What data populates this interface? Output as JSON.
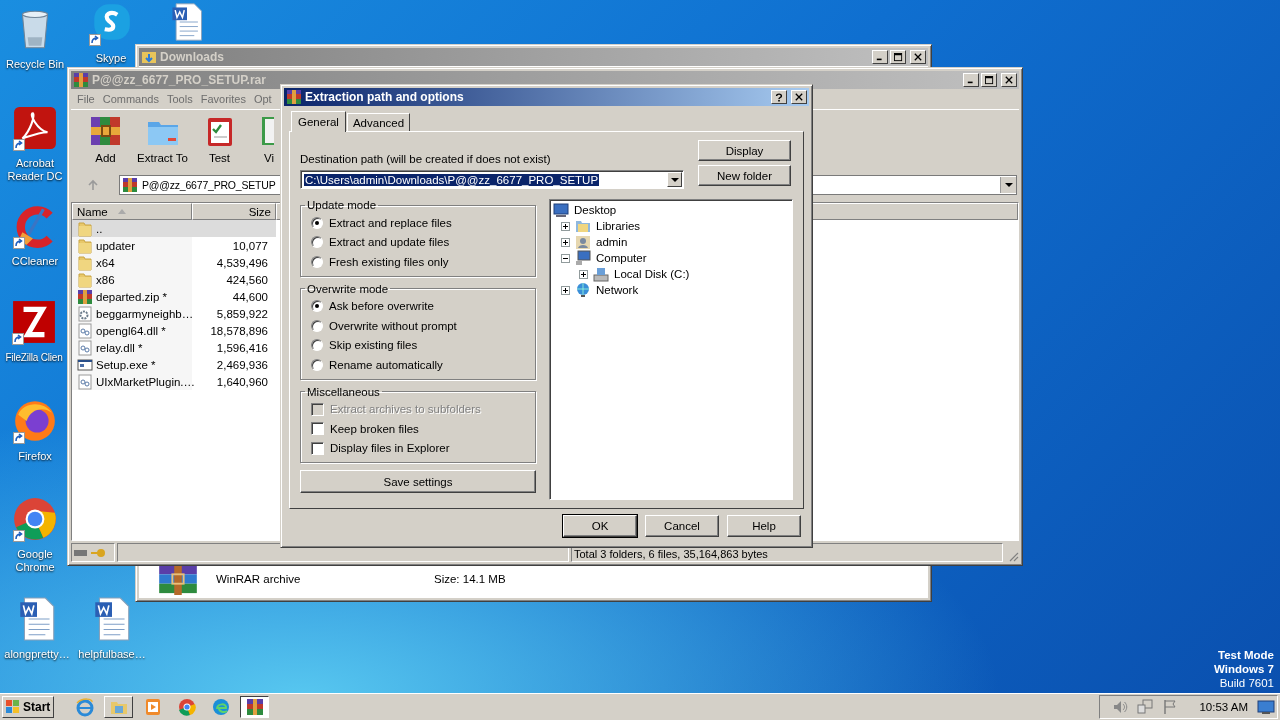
{
  "desktop_icons": [
    {
      "label": "Recycle Bin",
      "kind": "recycle",
      "shortcut": false
    },
    {
      "label": "Skype",
      "kind": "skype",
      "shortcut": true
    },
    {
      "kind": "word",
      "shortcut": false
    },
    {
      "label": "Acrobat Reader DC",
      "kind": "acrobat",
      "shortcut": true
    },
    {
      "label": "CCleaner",
      "kind": "ccleaner",
      "shortcut": true
    },
    {
      "label": "FileZilla Clien",
      "kind": "filezilla",
      "shortcut": true
    },
    {
      "label": "Firefox",
      "kind": "firefox",
      "shortcut": true
    },
    {
      "label": "Google Chrome",
      "kind": "chrome",
      "shortcut": true
    },
    {
      "label": "alongpretty…",
      "kind": "word",
      "shortcut": false
    },
    {
      "label": "helpfulbase…",
      "kind": "word",
      "shortcut": false
    }
  ],
  "downloads_window": {
    "title": "Downloads",
    "file_type": "WinRAR archive",
    "file_size": "Size: 14.1 MB"
  },
  "archive_window": {
    "title": "P@@zz_6677_PRO_SETUP.rar",
    "menu": [
      "File",
      "Commands",
      "Tools",
      "Favorites",
      "Opt"
    ],
    "toolbar": [
      {
        "label": "Add",
        "kind": "add"
      },
      {
        "label": "Extract To",
        "kind": "extract"
      },
      {
        "label": "Test",
        "kind": "test"
      },
      {
        "label": "Vi",
        "kind": "view"
      }
    ],
    "address": "P@@zz_6677_PRO_SETUP",
    "columns": [
      "Name",
      "Size"
    ],
    "rows": [
      {
        "name": "..",
        "kind": "parent",
        "selected": true
      },
      {
        "name": "updater",
        "size": "10,077",
        "kind": "folder",
        "selected": false
      },
      {
        "name": "x64",
        "size": "4,539,496",
        "kind": "folder",
        "selected": false
      },
      {
        "name": "x86",
        "size": "424,560",
        "kind": "folder",
        "selected": false
      },
      {
        "name": "departed.zip *",
        "size": "44,600",
        "kind": "archive",
        "selected": false
      },
      {
        "name": "beggarmyneighb…",
        "size": "5,859,922",
        "kind": "settings",
        "selected": false
      },
      {
        "name": "opengl64.dll *",
        "size": "18,578,896",
        "kind": "library",
        "selected": false
      },
      {
        "name": "relay.dll *",
        "size": "1,596,416",
        "kind": "library",
        "selected": false
      },
      {
        "name": "Setup.exe *",
        "size": "2,469,936",
        "kind": "program",
        "selected": false
      },
      {
        "name": "UIxMarketPlugin.…",
        "size": "1,640,960",
        "kind": "library",
        "selected": false
      }
    ],
    "status": "Total 3 folders, 6 files, 35,164,863 bytes"
  },
  "dialog": {
    "title": "Extraction path and options",
    "tabs": [
      {
        "label": "General",
        "selected": true
      },
      {
        "label": "Advanced",
        "selected": false
      }
    ],
    "path_label": "Destination path (will be created if does not exist)",
    "path_value": "C:\\Users\\admin\\Downloads\\P@@zz_6677_PRO_SETUP",
    "side_buttons": [
      "Display",
      "New folder"
    ],
    "update_mode": {
      "title": "Update mode",
      "options": [
        {
          "label": "Extract and replace files",
          "selected": true
        },
        {
          "label": "Extract and update files",
          "selected": false
        },
        {
          "label": "Fresh existing files only",
          "selected": false
        }
      ]
    },
    "overwrite_mode": {
      "title": "Overwrite mode",
      "options": [
        {
          "label": "Ask before overwrite",
          "selected": true
        },
        {
          "label": "Overwrite without prompt",
          "selected": false
        },
        {
          "label": "Skip existing files",
          "selected": false
        },
        {
          "label": "Rename automatically",
          "selected": false
        }
      ]
    },
    "miscellaneous": {
      "title": "Miscellaneous",
      "options": [
        {
          "label": "Extract archives to subfolders",
          "checked": false,
          "disabled": true
        },
        {
          "label": "Keep broken files",
          "checked": false,
          "disabled": false
        },
        {
          "label": "Display files in Explorer",
          "checked": false,
          "disabled": false
        }
      ]
    },
    "save_button": "Save settings",
    "tree": [
      {
        "label": "Desktop",
        "kind": "desktop",
        "children": [
          {
            "label": "Libraries",
            "kind": "libraries",
            "expanded": false
          },
          {
            "label": "admin",
            "kind": "user",
            "expanded": false
          },
          {
            "label": "Computer",
            "kind": "computer",
            "expanded": true,
            "children": [
              {
                "label": "Local Disk (C:)",
                "kind": "disk",
                "expanded": false
              }
            ]
          },
          {
            "label": "Network",
            "kind": "network",
            "expanded": false
          }
        ]
      }
    ],
    "buttons": [
      "OK",
      "Cancel",
      "Help"
    ]
  },
  "taskbar": {
    "start": "Start",
    "apps": [
      {
        "kind": "ie",
        "selected": false
      },
      {
        "kind": "explorer",
        "selected": false
      },
      {
        "kind": "media",
        "selected": false
      },
      {
        "kind": "chrome",
        "selected": false
      },
      {
        "kind": "edge",
        "selected": false
      },
      {
        "kind": "winrar",
        "selected": true
      }
    ],
    "clock": "10:53 AM"
  },
  "os_notice": {
    "lines": [
      "Test Mode",
      "Windows 7",
      "Build 7601"
    ]
  }
}
